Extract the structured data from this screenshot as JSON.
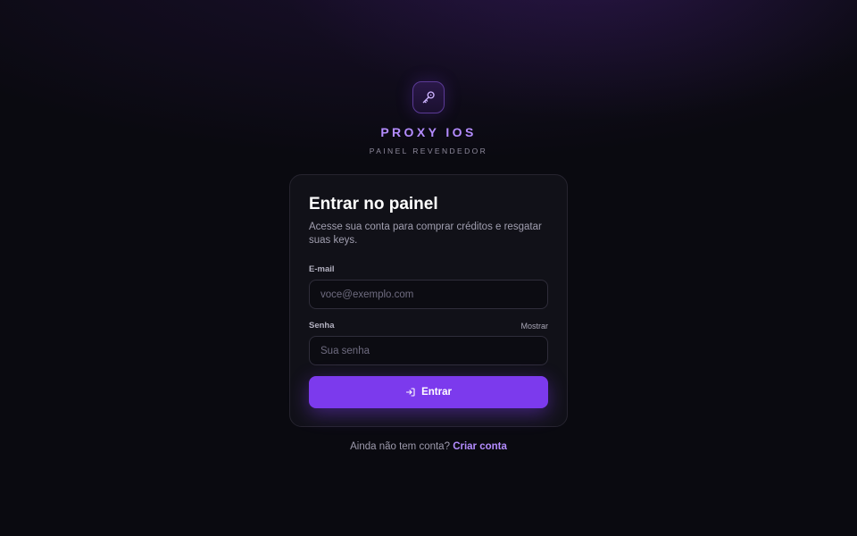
{
  "brand": {
    "logo_icon": "key-icon",
    "name": "PROXY IOS",
    "subtitle": "PAINEL REVENDEDOR"
  },
  "login": {
    "title": "Entrar no painel",
    "description": "Acesse sua conta para comprar créditos e resgatar suas keys.",
    "email": {
      "label": "E-mail",
      "placeholder": "voce@exemplo.com",
      "value": ""
    },
    "password": {
      "label": "Senha",
      "toggle_label": "Mostrar",
      "placeholder": "Sua senha",
      "value": ""
    },
    "submit": {
      "icon": "login-icon",
      "label": "Entrar"
    }
  },
  "footer": {
    "prompt": "Ainda não tem conta?",
    "link_label": "Criar conta"
  },
  "colors": {
    "accent": "#7c3aed",
    "brand_text": "#b48cff",
    "background": "#0a0a10",
    "card": "#111118"
  }
}
